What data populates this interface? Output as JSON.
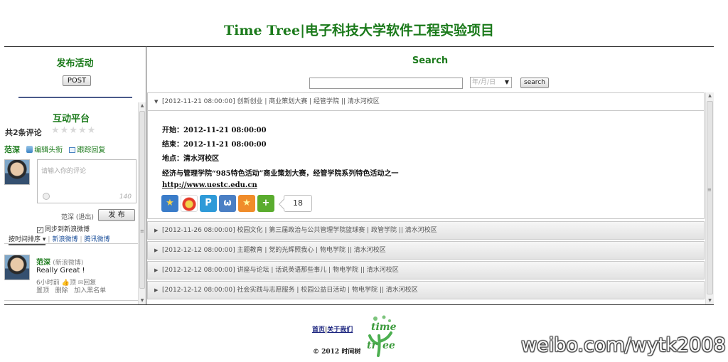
{
  "header": {
    "title": "Time Tree|电子科技大学软件工程实验项目"
  },
  "left": {
    "publish": {
      "title": "发布活动",
      "post_label": "POST"
    },
    "interact": {
      "title": "互动平台",
      "comment_count": "共2条评论",
      "stars": "★★★★★",
      "user_name": "范深",
      "edit_avatar": "编辑头衔",
      "follow_reply": "跟踪回复",
      "comment_placeholder": "请输入你的评论",
      "char_count": "140",
      "logout_text": "范深 (退出)",
      "send_label": "发 布",
      "sync_label": "同步到新浪微博",
      "sync_checked": "✓",
      "sort_tabs": [
        "按时间排序 ▾",
        "新浪微博",
        "腾讯微博"
      ]
    },
    "comments": [
      {
        "user": "范深",
        "source": "(新浪微博)",
        "text": "Really Great !",
        "time": "6小时前",
        "actions_1": [
          "顶",
          "回复"
        ],
        "actions_2": [
          "置顶",
          "删除",
          "加入黑名单"
        ]
      }
    ]
  },
  "search": {
    "title": "Search",
    "input_value": "",
    "date_placeholder": "年/月/日",
    "date_arrow": "▼",
    "button_label": "search"
  },
  "events": [
    {
      "label": "[2012-11-21 08:00:00] 创新创业 | 商业策划大赛 | 经管学院 || 清水河校区",
      "expanded": true,
      "start": "开始：2012-11-21 08:00:00",
      "end": "结束：2012-11-21 08:00:00",
      "location": "地点：清水河校区",
      "description": "经济与管理学院“985特色活动”商业策划大赛，经管学院系列特色活动之一",
      "link": "http://www.uestc.edu.cn",
      "share_icons": [
        "qzone-icon",
        "weibo-icon",
        "pengyou-icon",
        "renren-icon",
        "qq-star-icon",
        "more-share-icon"
      ],
      "share_count": "18"
    },
    {
      "label": "[2012-11-26 08:00:00] 校园文化 | 第三届政治与公共管理学院篮球赛 | 政管学院 || 清水河校区",
      "expanded": false
    },
    {
      "label": "[2012-12-12 08:00:00] 主题教育 | 党的光辉照我心 | 物电学院 || 清水河校区",
      "expanded": false
    },
    {
      "label": "[2012-12-12 08:00:00] 讲座与论坛 | 话说英语那些事儿 | 物电学院 || 清水河校区",
      "expanded": false
    },
    {
      "label": "[2012-12-12 08:00:00] 社会实践与志愿服务 | 校园公益日活动 | 物电学院 || 清水河校区",
      "expanded": false
    }
  ],
  "footer": {
    "home": "首页",
    "sep": "|",
    "about": "关于我们",
    "copyright": "© 2012 时间树",
    "logo_text": "time tree"
  },
  "watermark": "weibo.com/wytk2008",
  "colors": {
    "accent_green": "#1b7a1b",
    "link_blue": "#1a237e"
  }
}
